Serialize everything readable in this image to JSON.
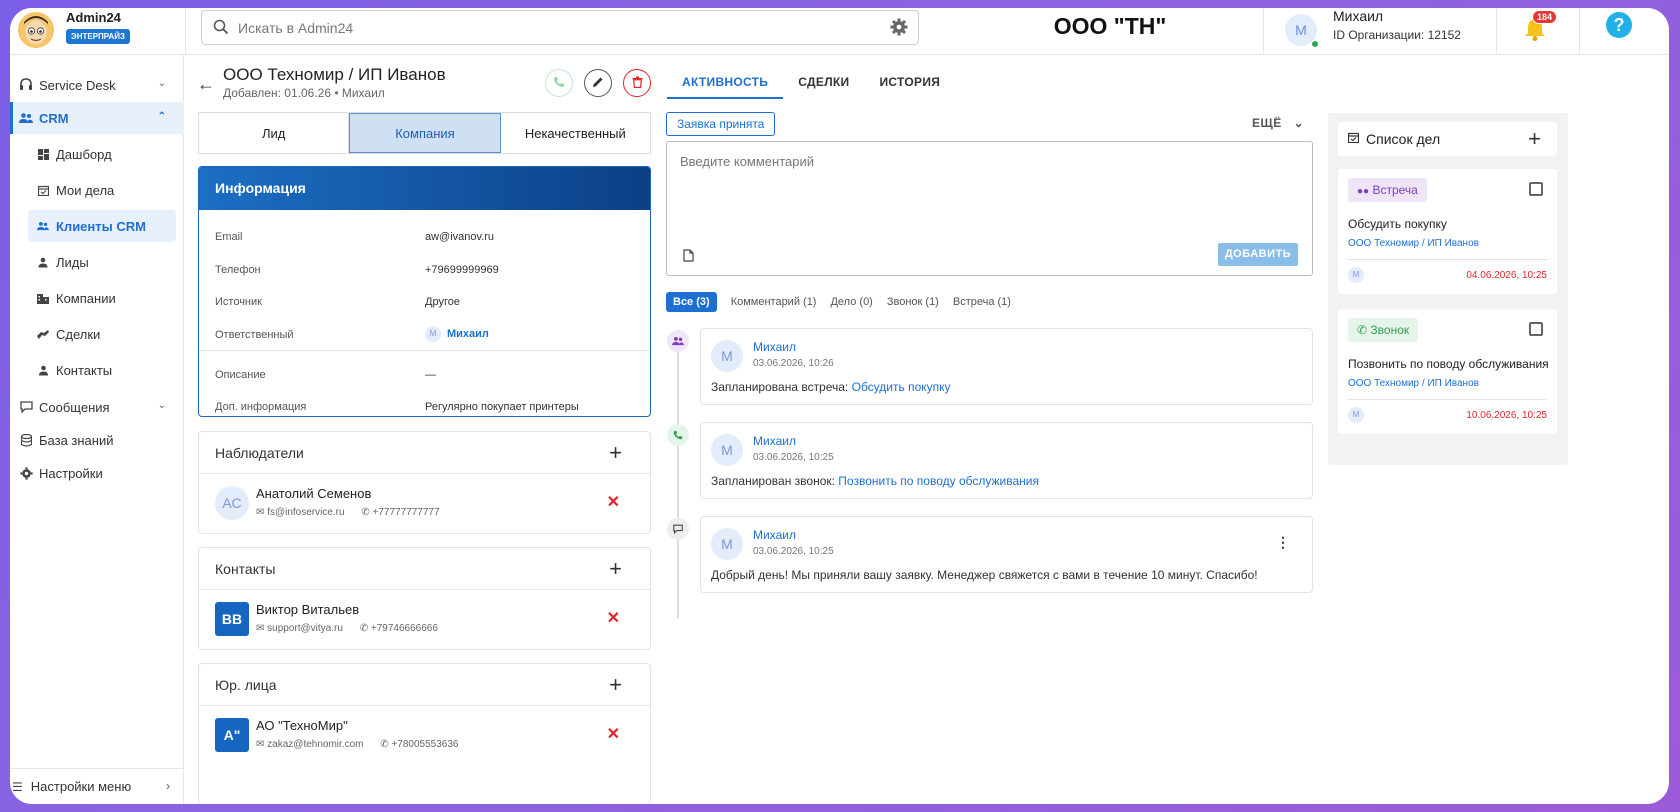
{
  "brand": {
    "name": "Admin24",
    "badge": "ЭНТЕРПРАЙЗ"
  },
  "search": {
    "placeholder": "Искать в Admin24"
  },
  "header": {
    "org_title": "ООО \"ТН\""
  },
  "user": {
    "avatar": "М",
    "name": "Михаил",
    "org_id": "ID Организации: 12152"
  },
  "notifications": {
    "count": "184"
  },
  "help": {
    "label": "?"
  },
  "sidebar": {
    "items": [
      {
        "label": "Service Desk",
        "icon": "headset-icon"
      },
      {
        "label": "CRM",
        "icon": "people-icon"
      },
      {
        "label": "Сообщения",
        "icon": "chat-icon"
      },
      {
        "label": "База знаний",
        "icon": "database-icon"
      },
      {
        "label": "Настройки",
        "icon": "gear-icon"
      }
    ],
    "crm_sub": [
      {
        "label": "Дашборд",
        "icon": "dashboard-icon"
      },
      {
        "label": "Мои дела",
        "icon": "calendar-icon"
      },
      {
        "label": "Клиенты CRM",
        "icon": "people-icon"
      },
      {
        "label": "Лиды",
        "icon": "person-icon"
      },
      {
        "label": "Компании",
        "icon": "building-icon"
      },
      {
        "label": "Сделки",
        "icon": "handshake-icon"
      },
      {
        "label": "Контакты",
        "icon": "contact-icon"
      }
    ],
    "menu_settings": "Настройки меню"
  },
  "company": {
    "title": "ООО Техномир / ИП Иванов",
    "subtitle": "Добавлен: 01.06.26 • Михаил"
  },
  "type_tabs": [
    "Лид",
    "Компания",
    "Некачественный"
  ],
  "info": {
    "header": "Информация",
    "rows": [
      {
        "label": "Email",
        "value": "aw@ivanov.ru"
      },
      {
        "label": "Телефон",
        "value": "+79699999969"
      },
      {
        "label": "Источник",
        "value": "Другое"
      },
      {
        "label": "Ответственный",
        "value": "Михаил",
        "avatar": "М"
      },
      {
        "label": "Описание",
        "value": "—"
      },
      {
        "label": "Доп. информация",
        "value": "Регулярно покупает принтеры"
      }
    ]
  },
  "observers": {
    "title": "Наблюдатели",
    "person": {
      "initials": "АС",
      "name": "Анатолий Семенов",
      "email": "fs@infoservice.ru",
      "phone": "+77777777777"
    }
  },
  "contacts": {
    "title": "Контакты",
    "person": {
      "initials": "ВВ",
      "name": "Виктор Витальев",
      "email": "support@vitya.ru",
      "phone": "+79746666666"
    }
  },
  "legal": {
    "title": "Юр. лица",
    "person": {
      "initials": "А\"",
      "name": "АО \"ТехноМир\"",
      "email": "zakaz@tehnomir.com",
      "phone": "+78005553636"
    }
  },
  "activity_tabs": [
    "АКТИВНОСТЬ",
    "СДЕЛКИ",
    "ИСТОРИЯ"
  ],
  "status_chip": "Заявка принята",
  "more_label": "ЕЩЁ",
  "comment": {
    "placeholder": "Введите комментарий",
    "add_label": "ДОБАВИТЬ"
  },
  "filters": [
    "Все (3)",
    "Комментарий (1)",
    "Дело (0)",
    "Звонок (1)",
    "Встреча (1)"
  ],
  "timeline": [
    {
      "avatar": "М",
      "author": "Михаил",
      "date": "03.06.2026, 10:26",
      "text": "Запланирована встреча: ",
      "link": "Обсудить покупку",
      "icon": "meeting-icon"
    },
    {
      "avatar": "М",
      "author": "Михаил",
      "date": "03.06.2026, 10:25",
      "text": "Запланирован звонок: ",
      "link": "Позвонить по поводу обслуживания",
      "icon": "phone-icon"
    },
    {
      "avatar": "М",
      "author": "Михаил",
      "date": "03.06.2026, 10:25",
      "text": "Добрый день! Мы приняли вашу заявку. Менеджер свяжется с вами в течение 10 минут. Спасибо!",
      "link": "",
      "icon": "comment-icon"
    }
  ],
  "todo": {
    "title": "Список дел",
    "items": [
      {
        "chip": "Встреча",
        "text": "Обсудить покупку",
        "link": "ООО Техномир / ИП Иванов",
        "avatar": "М",
        "date": "04.06.2026, 10:25"
      },
      {
        "chip": "Звонок",
        "text": "Позвонить по поводу обслуживания",
        "link": "ООО Техномир / ИП Иванов",
        "avatar": "М",
        "date": "10.06.2026, 10:25"
      }
    ]
  },
  "colors": {
    "accent": "#1d6fd1",
    "danger": "#e0242c",
    "meeting": "#7b3fb8",
    "call": "#2e9e4f"
  }
}
